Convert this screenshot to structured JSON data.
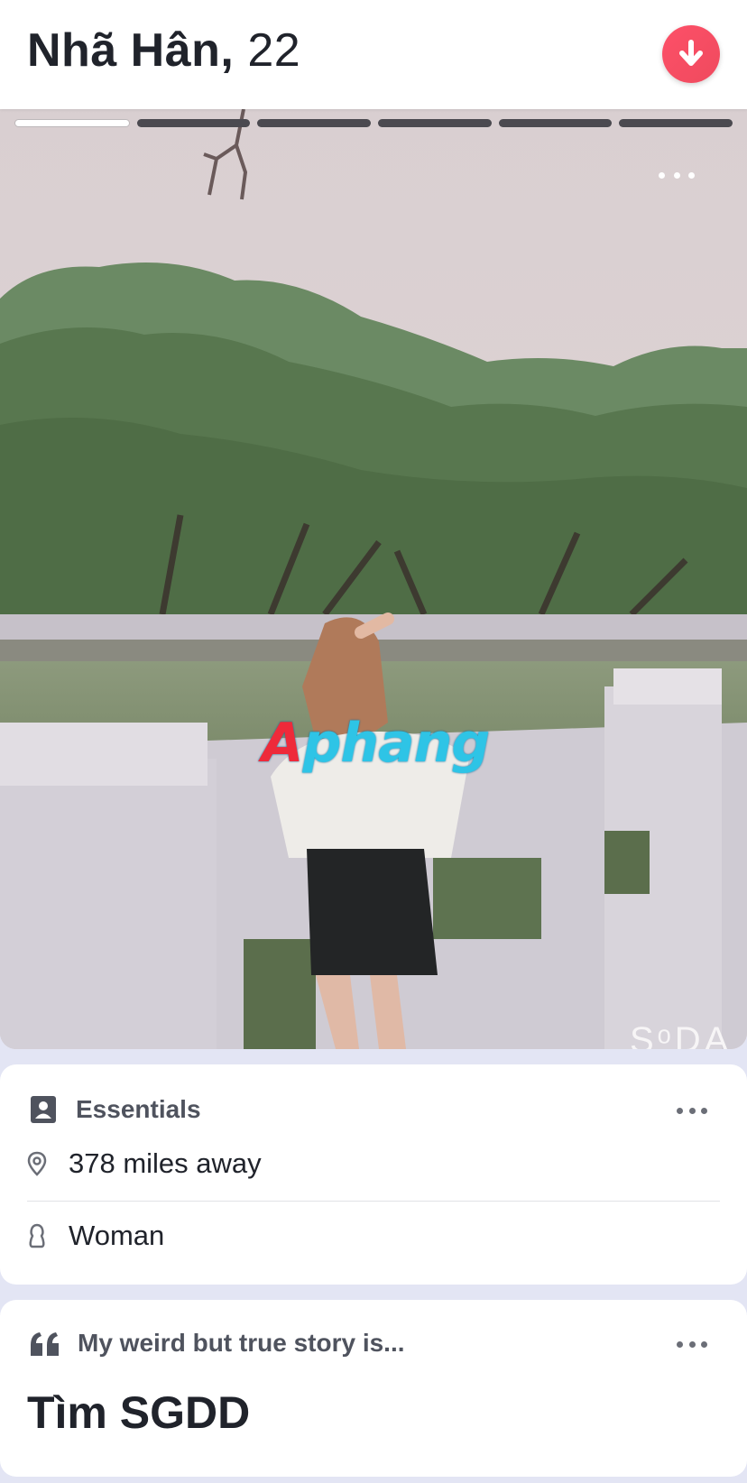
{
  "header": {
    "name": "Nhã Hân,",
    "age": "22"
  },
  "photo": {
    "total_photos": 6,
    "active_photo_index": 0,
    "watermark_first": "A",
    "watermark_rest": "phang",
    "corner_text": "SᵒDA"
  },
  "essentials": {
    "title": "Essentials",
    "distance": "378 miles away",
    "gender": "Woman"
  },
  "story": {
    "prompt": "My weird but true story is...",
    "answer": "Tìm SGDD"
  },
  "colors": {
    "accent": "#fd5068",
    "text_dark": "#20232b",
    "text_muted": "#4f535e",
    "page_bg": "#e3e5f4"
  }
}
